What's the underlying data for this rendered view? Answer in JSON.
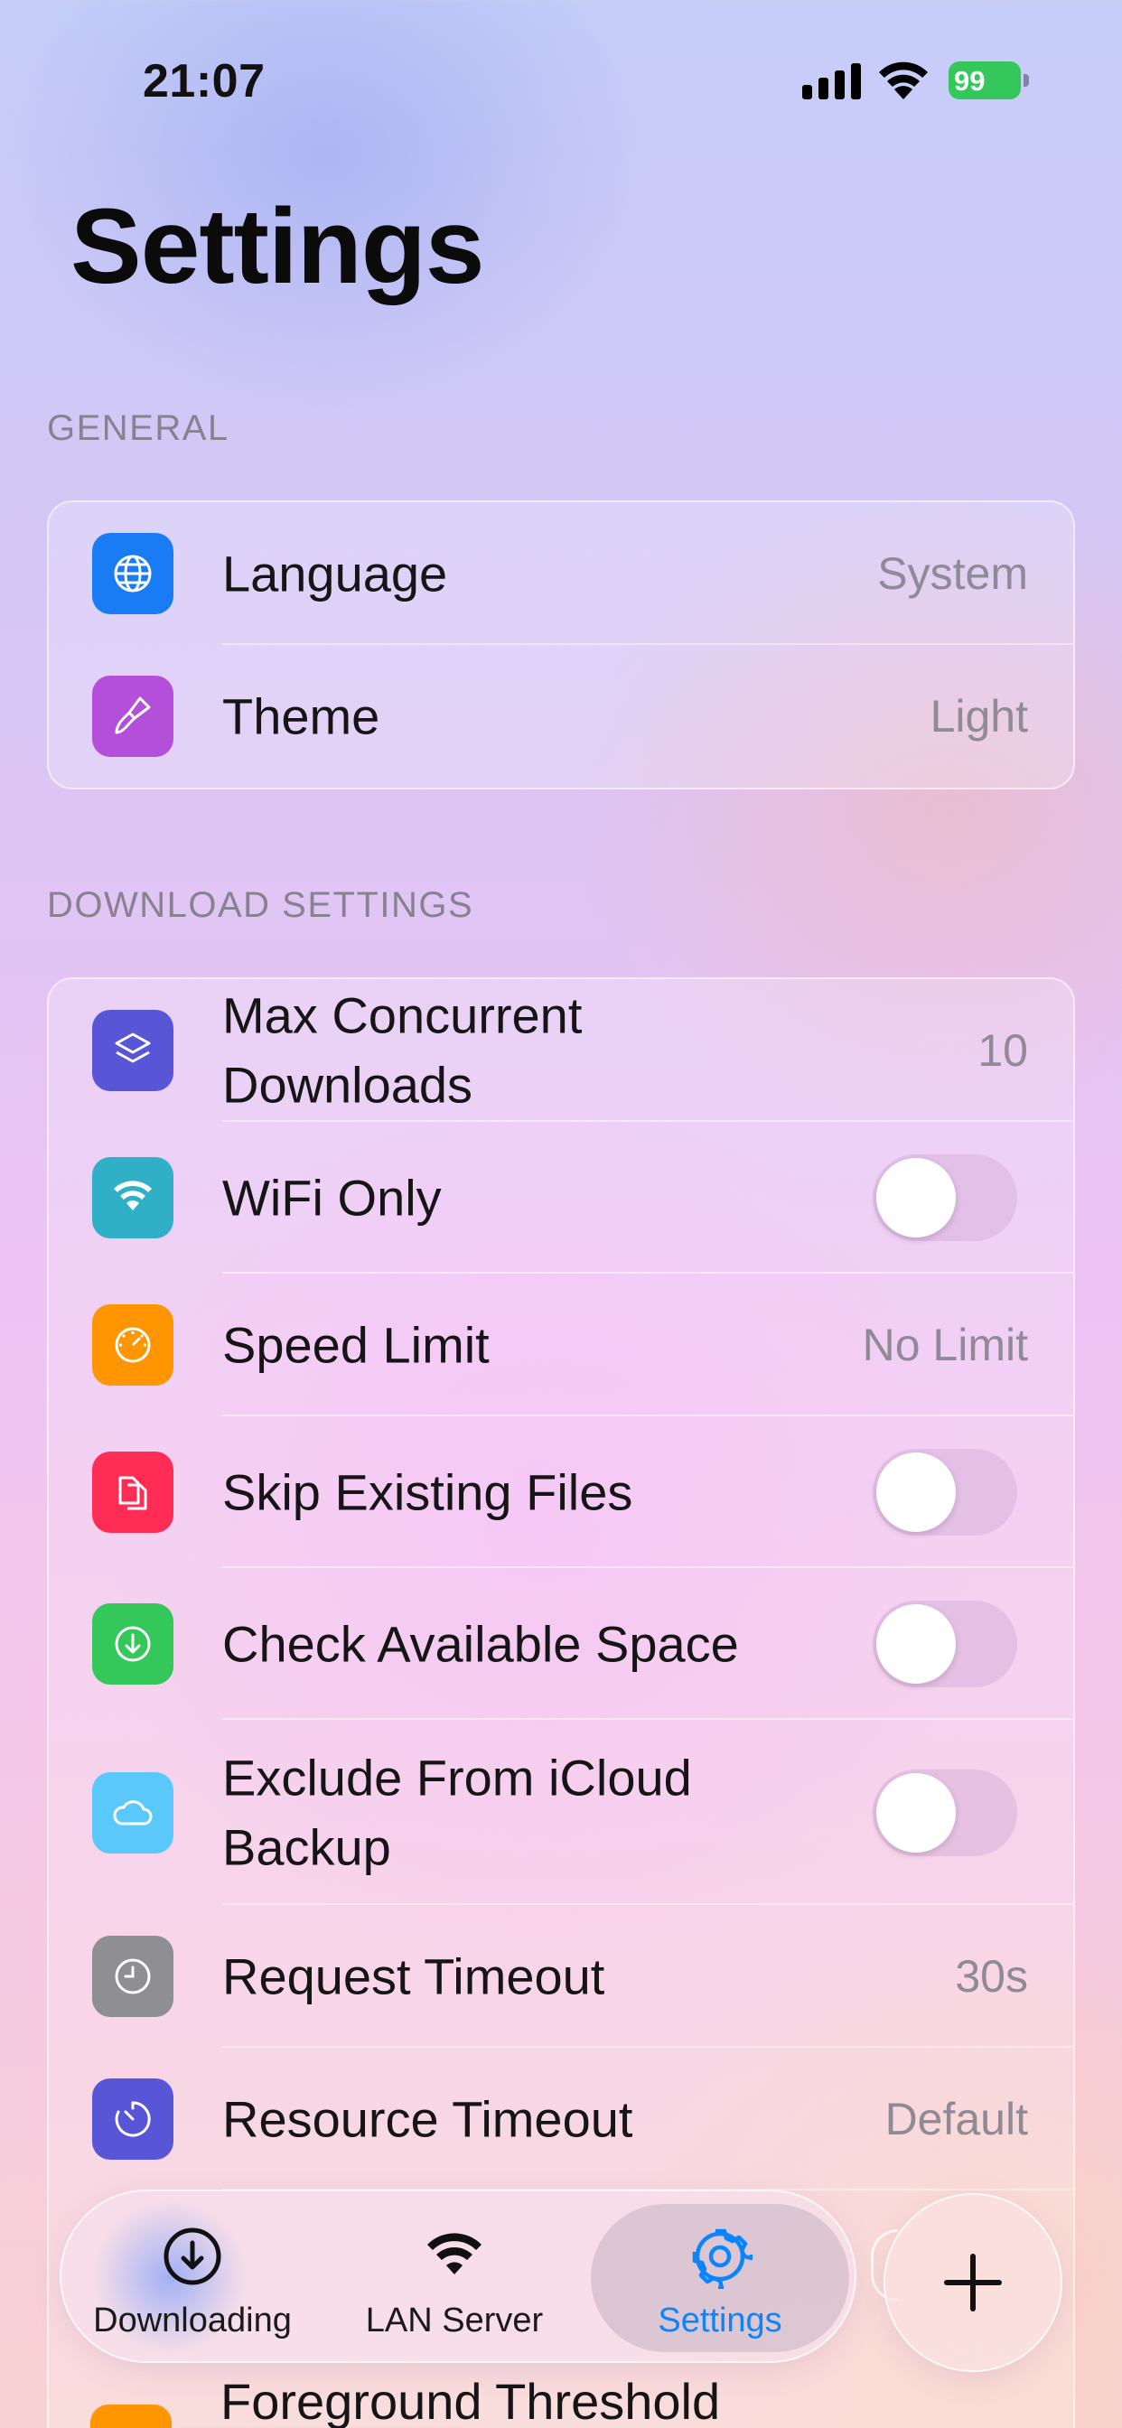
{
  "status_bar": {
    "time": "21:07",
    "battery": "99",
    "icons": [
      "cellular-signal-icon",
      "wifi-icon",
      "battery-charging-icon"
    ]
  },
  "page": {
    "title": "Settings"
  },
  "sections": {
    "general": {
      "header": "GENERAL",
      "rows": {
        "language": {
          "label": "Language",
          "value": "System",
          "icon": "globe-icon",
          "color": "#1a7cf5"
        },
        "theme": {
          "label": "Theme",
          "value": "Light",
          "icon": "paintbrush-icon",
          "color": "#b34fd9"
        }
      }
    },
    "download": {
      "header": "DOWNLOAD SETTINGS",
      "rows": {
        "max_concurrent": {
          "label": "Max Concurrent Downloads",
          "value": "10",
          "icon": "layers-icon",
          "color": "#5856d6"
        },
        "wifi_only": {
          "label": "WiFi Only",
          "on": false,
          "icon": "wifi-icon",
          "color": "#30b0c7"
        },
        "speed_limit": {
          "label": "Speed Limit",
          "value": "No Limit",
          "icon": "speedometer-icon",
          "color": "#ff9500"
        },
        "skip_existing": {
          "label": "Skip Existing Files",
          "on": false,
          "icon": "documents-icon",
          "color": "#ff2d55"
        },
        "check_space": {
          "label": "Check Available Space",
          "on": false,
          "icon": "download-circle-icon",
          "color": "#34c759"
        },
        "exclude_icloud": {
          "label": "Exclude From iCloud Backup",
          "on": false,
          "icon": "cloud-icon",
          "color": "#5ac8fa"
        },
        "request_timeout": {
          "label": "Request Timeout",
          "value": "30s",
          "icon": "clock-icon",
          "color": "#8e8e93"
        },
        "resource_timeout": {
          "label": "Resource Timeout",
          "value": "Default",
          "icon": "timer-icon",
          "color": "#5856d6"
        },
        "foreground_threshold": {
          "label": "Foreground Threshold",
          "icon": "threshold-icon",
          "color": "#ff9500"
        }
      }
    }
  },
  "tab_bar": {
    "tabs": [
      {
        "label": "Downloading",
        "icon": "download-circle-icon"
      },
      {
        "label": "LAN Server",
        "icon": "wifi-icon"
      },
      {
        "label": "Settings",
        "icon": "gear-icon",
        "active": true
      }
    ],
    "active_color": "#0a84ff",
    "fab_icon": "plus-icon"
  }
}
